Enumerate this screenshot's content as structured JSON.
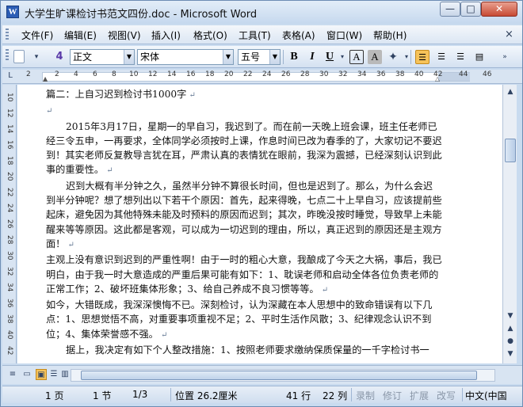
{
  "window": {
    "title": "大学生旷课检讨书范文四份.doc - Microsoft Word",
    "app_icon": "W",
    "min_label": "—",
    "max_label": "□",
    "close_label": "✕"
  },
  "menu": {
    "items": [
      "文件(F)",
      "编辑(E)",
      "视图(V)",
      "插入(I)",
      "格式(O)",
      "工具(T)",
      "表格(A)",
      "窗口(W)",
      "帮助(H)"
    ],
    "close_doc": "×"
  },
  "toolbar": {
    "style_value": "正文",
    "font_value": "宋体",
    "size_value": "五号",
    "bold": "B",
    "italic": "I",
    "underline": "U",
    "char_border": "A",
    "char_shading": "A",
    "style_icon": "4",
    "icons": [
      "new-document-icon",
      "styles-pane-icon",
      "bold-icon",
      "italic-icon",
      "underline-icon",
      "char-border-icon",
      "char-shading-icon",
      "highlight-icon",
      "align-left-icon",
      "align-center-icon",
      "align-justify-icon"
    ]
  },
  "ruler": {
    "numbers": [
      "2",
      "2",
      "4",
      "6",
      "8",
      "10",
      "12",
      "14",
      "16",
      "18",
      "20",
      "22",
      "24",
      "26",
      "28",
      "30",
      "32",
      "34",
      "36",
      "38",
      "40",
      "42",
      "44",
      "46"
    ]
  },
  "vruler": {
    "numbers": [
      "10",
      "12",
      "14",
      "16",
      "18",
      "20",
      "22",
      "24",
      "26",
      "28",
      "30",
      "32",
      "34",
      "36",
      "38",
      "40",
      "42",
      "44"
    ]
  },
  "document": {
    "heading": "篇二：上自习迟到检讨书1000字",
    "paragraphs": [
      "2015年3月17日，星期一的早自习，我迟到了。而在前一天晚上班会课，班主任老师已经三令五申，一再要求，全体同学必须按时上课，作息时间已改为春季的了，大家切记不要迟到！其实老师反复教导言犹在耳，严肃认真的表情犹在眼前，我深为震撼，已经深刻认识到此事的重要性。",
      "迟到大概有半分钟之久，虽然半分钟不算很长时间，但也是迟到了。那么，为什么会迟到半分钟呢？想了想列出以下若干个原因：首先，起来得晚，七点二十上早自习，应该提前些起床，避免因为其他特殊未能及时预料的原因而迟到；其次，昨晚没按时睡觉，导致早上未能醒来等等原因。这此都是客观，可以成为一切迟到的理由，所以，真正迟到的原因还是主观方面！",
      "主观上没有意识到迟到的严重性啊！由于一时的粗心大意，我酿成了今天之大祸，事后，我已明白，由于我一时大意造成的严重后果可能有如下：1、耽误老师和启动全体各位负责老师的正常工作；2、破坏班集体形象；3、给自己养成不良习惯等等。",
      "如今，大错既成，我深深懊悔不已。深刻检讨，认为深藏在本人思想中的致命错误有以下几点：1、思想觉悟不高，对重要事项重视不足；2、平时生活作风散；3、纪律观念认识不到位；4、集体荣誉感不强。",
      "据上，我决定有如下个人整改措施：1、按照老师要求缴纳保质保量的一千字检讨书一"
    ]
  },
  "status": {
    "page": "1 页",
    "section": "1 节",
    "page_of": "1/3",
    "position": "位置 26.2厘米",
    "line": "41 行",
    "column": "22 列",
    "rec": "录制",
    "trk": "修订",
    "ext": "扩展",
    "ovr": "改写",
    "lang": "中文(中国"
  }
}
